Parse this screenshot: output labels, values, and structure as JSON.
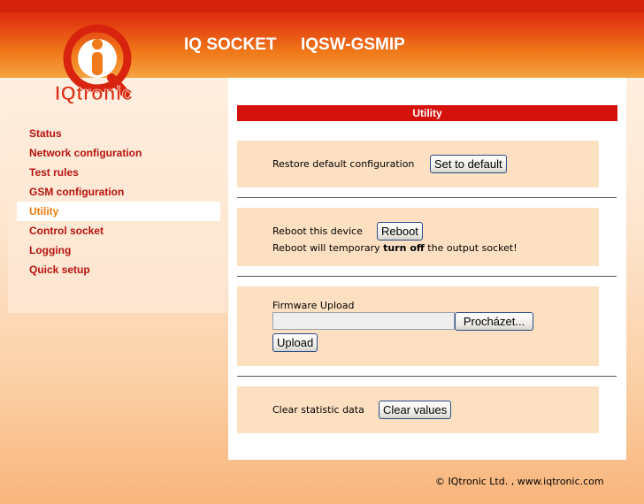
{
  "header": {
    "product": "IQ SOCKET",
    "model": "IQSW-GSMIP",
    "logo_text": "IQtronic"
  },
  "sidebar": {
    "items": [
      {
        "label": "Status",
        "active": false
      },
      {
        "label": "Network configuration",
        "active": false
      },
      {
        "label": "Test rules",
        "active": false
      },
      {
        "label": "GSM configuration",
        "active": false
      },
      {
        "label": "Utility",
        "active": true
      },
      {
        "label": "Control socket",
        "active": false
      },
      {
        "label": "Logging",
        "active": false
      },
      {
        "label": "Quick setup",
        "active": false
      }
    ]
  },
  "page": {
    "heading": "Utility",
    "restore": {
      "label": "Restore default configuration",
      "button": "Set to default"
    },
    "reboot": {
      "label": "Reboot this device",
      "button": "Reboot",
      "warning_pre": "Reboot will temporary ",
      "warning_bold": "turn off",
      "warning_post": " the output socket!"
    },
    "firmware": {
      "label": "Firmware Upload",
      "file_value": "",
      "browse_button": "Procházet...",
      "upload_button": "Upload"
    },
    "clear": {
      "label": "Clear statistic data",
      "button": "Clear values"
    }
  },
  "footer": {
    "text": "© IQtronic Ltd. , www.iqtronic.com"
  },
  "colors": {
    "accent_red": "#d5110c",
    "nav_red": "#b8130f",
    "nav_active": "#f27a0c",
    "panel": "#fde0c2"
  }
}
